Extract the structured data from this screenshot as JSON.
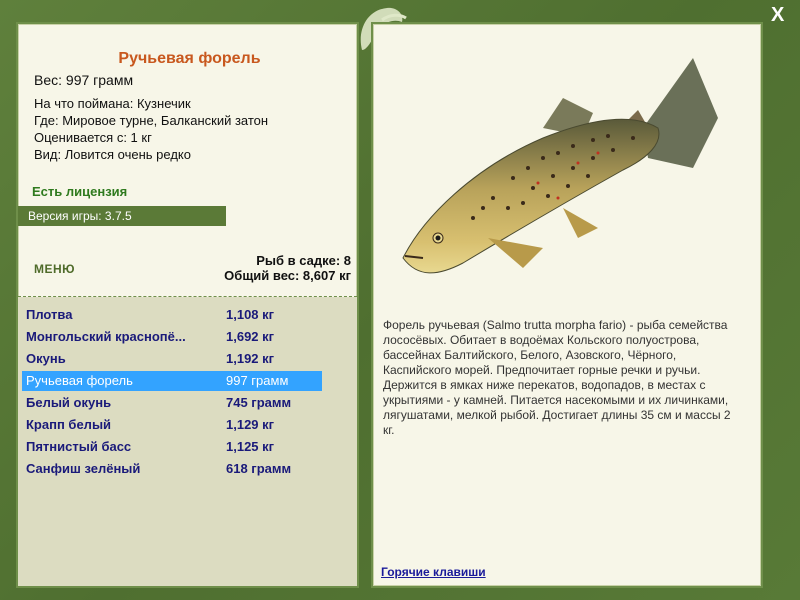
{
  "close_label": "X",
  "fish": {
    "title": "Ручьевая форель",
    "weight": "Вес: 997 грамм",
    "caught_on": "На что поймана: Кузнечик",
    "location": "Где: Мировое турне, Балканский затон",
    "valued_from": "Оценивается с: 1 кг",
    "rarity": "Вид: Ловится очень редко"
  },
  "license": "Есть лицензия",
  "version": "Версия игры: 3.7.5",
  "menu_label": "МЕНЮ",
  "cage": {
    "count": "Рыб в садке: 8",
    "total": "Общий вес: 8,607 кг"
  },
  "list": [
    {
      "name": "Плотва",
      "weight": "1,108 кг"
    },
    {
      "name": "Монгольский краснопё...",
      "weight": "1,692 кг"
    },
    {
      "name": "Окунь",
      "weight": "1,192 кг"
    },
    {
      "name": "Ручьевая форель",
      "weight": "997 грамм"
    },
    {
      "name": "Белый окунь",
      "weight": "745 грамм"
    },
    {
      "name": "Крапп белый",
      "weight": "1,129 кг"
    },
    {
      "name": "Пятнистый басс",
      "weight": "1,125 кг"
    },
    {
      "name": "Санфиш зелёный",
      "weight": "618 грамм"
    }
  ],
  "selected_index": 3,
  "description": "Форель ручьевая (Salmo trutta morpha fario) - рыба семейства лососёвых. Обитает в водоёмах Кольского полуострова, бассейнах Балтийского, Белого, Азовского, Чёрного, Каспийского морей. Предпочитает горные речки и ручьи. Держится в ямках ниже перекатов, водопадов, в местах с укрытиями - у камней. Питается насекомыми и их личинками, лягушатами, мелкой рыбой. Достигает длины 35 см и массы 2 кг.",
  "hotkeys": "Горячие клавиши",
  "colors": {
    "frame": "#5b7a3a",
    "panel": "#f7f6e8",
    "title": "#c8581e",
    "license": "#2f7a1e",
    "selection": "#33a3ff",
    "list_text": "#1a1a7a"
  }
}
